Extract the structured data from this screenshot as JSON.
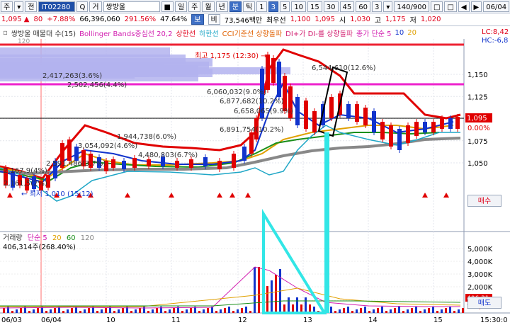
{
  "toolbar1": {
    "items": [
      "주",
      "▾",
      "전",
      "IT02280",
      "Q",
      "거",
      "쌍방울",
      "■",
      "일",
      "주",
      "월",
      "년",
      "분",
      "틱",
      "1",
      "3",
      "5",
      "10",
      "15",
      "30",
      "45",
      "60",
      "3",
      "▾",
      "140/900",
      "□",
      "□",
      "◀",
      "▶",
      "06/04"
    ],
    "selected": [
      "분",
      "3"
    ]
  },
  "quote": {
    "price": "1,095 ▲",
    "change": "80",
    "rate": "+7.88%",
    "volume": "66,396,060",
    "vol_ratio": "291.56%",
    "power": "47.64%",
    "view_btn": "보",
    "ratio_btn": "비",
    "amount": "73,546백만",
    "sell_label": "최우선",
    "best_ask": "1,100",
    "best_bid": "1,095",
    "open_label": "시",
    "open": "1,030",
    "high_label": "고",
    "high": "1,175",
    "low_label": "저",
    "low": "1,020"
  },
  "indicator_bar": {
    "label1": "쌍방울 매물대 수(15)",
    "label2": "Bollinger Bands중심선 20,2",
    "label3": "상한선",
    "label4": "하한선",
    "label5": "CCI기준선 상향돌파",
    "label6": "DI+가 DI-를 상향돌파",
    "label7": "종가 단순 5",
    "label8": "10",
    "label9": "20",
    "lc": "LC:8,42",
    "hc": "HC:-6,8"
  },
  "price_axis": [
    "1,150",
    "1,125",
    "1,100",
    "1,075",
    "1,050"
  ],
  "price_axis_extra": {
    "top": "120",
    "current": "1,095",
    "current_pct": "0.00%"
  },
  "side_buttons": {
    "top": "매수",
    "bottom": "매도"
  },
  "annotations": {
    "high": "최고 1,175 (12:30) →",
    "low": "← 최저 1,010 (15:12)",
    "vp": [
      "6,544,610(12.6%)",
      "2,417,263(3.6%)",
      "2,502,456(4.4%)",
      "6,060,032(9.0%)",
      "6,877,682(10.2%)",
      "6,658,065(9.9%)",
      "6,891,754(10.2%)",
      "1,944,738(6.0%)",
      "3,054,092(4.6%)",
      "2,591,486(3.7%)",
      "4,480,803(6.7%)",
      "2,167,9(4%)",
      "2,161,5(2%)"
    ]
  },
  "volume_panel": {
    "title": "거래량",
    "ma_label": "단순 5",
    "ma_20": "20",
    "ma_60": "60",
    "ma_120": "120",
    "info": "406,314주(268.40%)",
    "axis": [
      "5,000K",
      "4,000K",
      "3,000K",
      "2,000K",
      "1,000K"
    ],
    "current": "406,31",
    "current_pct": "268,40"
  },
  "time_axis": [
    "06/03",
    "06/04",
    "10",
    "11",
    "12",
    "13",
    "14",
    "15",
    "15:30:0"
  ],
  "chart_data": {
    "type": "bar",
    "title": "",
    "ylim": [
      1030,
      1175
    ]
  }
}
